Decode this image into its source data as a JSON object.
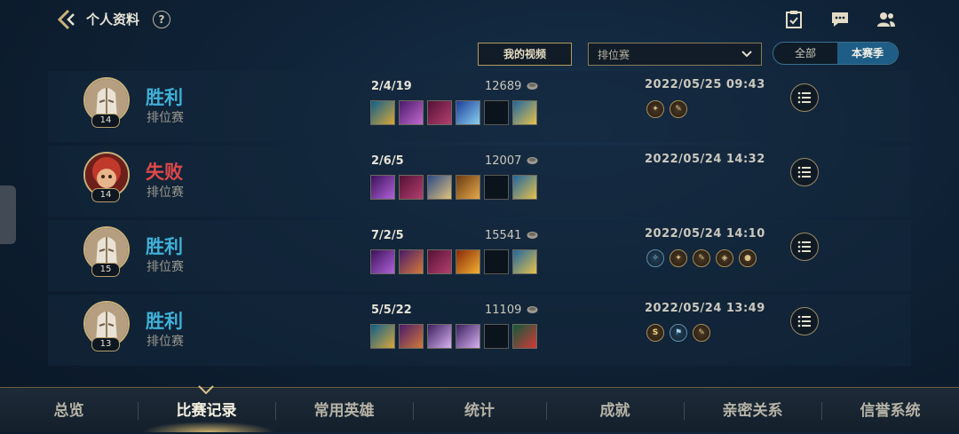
{
  "header": {
    "title": "个人资料",
    "help_label": "?",
    "icons": [
      "back-chevron-icon",
      "help-icon",
      "task-clipboard-icon",
      "chat-icon",
      "friends-icon"
    ]
  },
  "filters": {
    "video_button": "我的视频",
    "mode_select": {
      "value": "排位赛"
    },
    "season_toggle": {
      "options": [
        "全部",
        "本赛季"
      ],
      "selected": "本赛季"
    }
  },
  "matches": [
    {
      "result": "胜利",
      "outcome": "win",
      "mode": "排位赛",
      "level": "14",
      "kda": "2/4/19",
      "gold": "12689",
      "datetime": "2022/05/25 09:43",
      "badges": 2
    },
    {
      "result": "失败",
      "outcome": "lose",
      "mode": "排位赛",
      "level": "14",
      "kda": "2/6/5",
      "gold": "12007",
      "datetime": "2022/05/24 14:32",
      "badges": 0
    },
    {
      "result": "胜利",
      "outcome": "win",
      "mode": "排位赛",
      "level": "15",
      "kda": "7/2/5",
      "gold": "15541",
      "datetime": "2022/05/24 14:10",
      "badges": 5
    },
    {
      "result": "胜利",
      "outcome": "win",
      "mode": "排位赛",
      "level": "13",
      "kda": "5/5/22",
      "gold": "11109",
      "datetime": "2022/05/24 13:49",
      "badges": 3,
      "first_badge_label": "S"
    }
  ],
  "bottom_nav": {
    "tabs": [
      "总览",
      "比赛记录",
      "常用英雄",
      "统计",
      "成就",
      "亲密关系",
      "信誉系统"
    ],
    "active": "比赛记录"
  },
  "colors": {
    "win": "#3fb1d8",
    "lose": "#e04848",
    "gold_accent": "#c9b07a"
  }
}
